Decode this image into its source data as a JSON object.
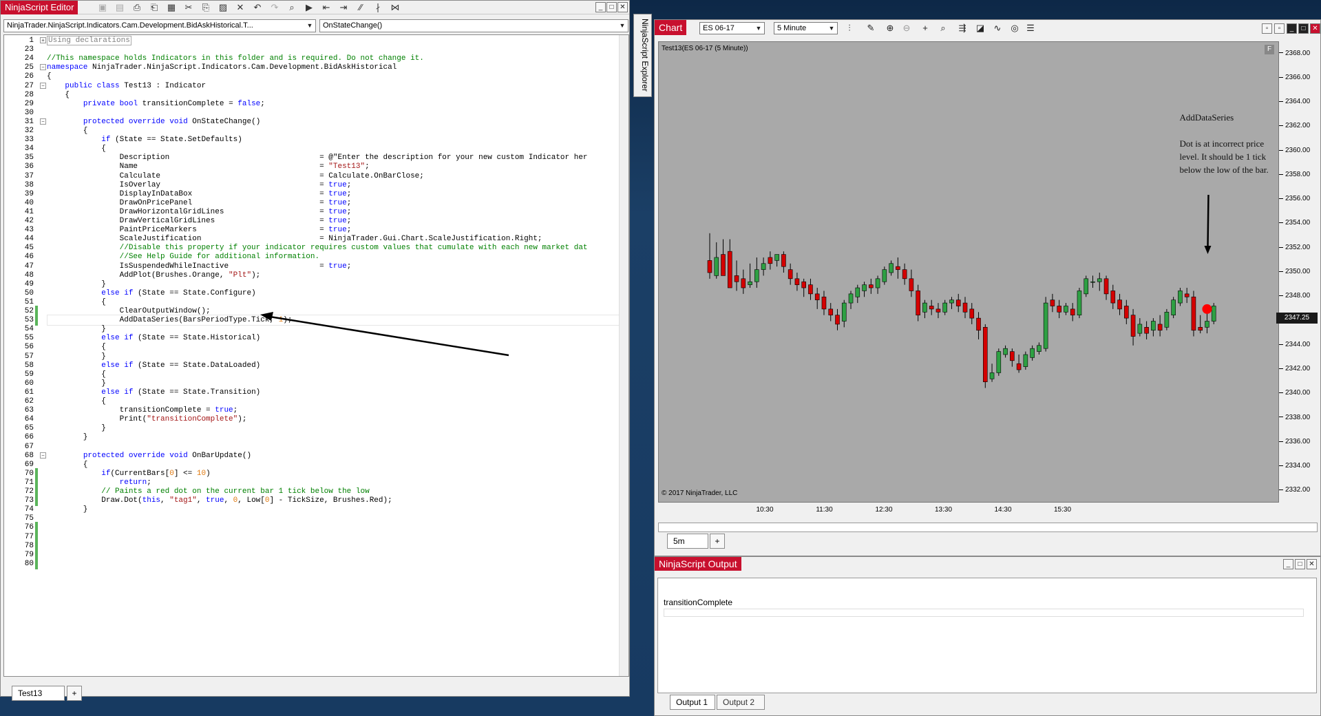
{
  "editor": {
    "title": "NinjaScript Editor",
    "file_dropdown": "NinjaTrader.NinjaScript.Indicators.Cam.Development.BidAskHistorical.T...",
    "method_dropdown": "OnStateChange()",
    "tab_name": "Test13",
    "add_tab": "+",
    "lines": [
      {
        "n": "1",
        "t": "Using declarations"
      },
      {
        "n": "23",
        "t": ""
      },
      {
        "n": "24",
        "t": "//This namespace holds Indicators in this folder and is required. Do not change it."
      },
      {
        "n": "25",
        "t": "namespace NinjaTrader.NinjaScript.Indicators.Cam.Development.BidAskHistorical"
      },
      {
        "n": "26",
        "t": "{"
      },
      {
        "n": "27",
        "t": "    public class Test13 : Indicator"
      },
      {
        "n": "28",
        "t": "    {"
      },
      {
        "n": "29",
        "t": "        private bool transitionComplete = false;"
      },
      {
        "n": "30",
        "t": ""
      },
      {
        "n": "31",
        "t": "        protected override void OnStateChange()"
      },
      {
        "n": "32",
        "t": "        {"
      },
      {
        "n": "33",
        "t": "            if (State == State.SetDefaults)"
      },
      {
        "n": "34",
        "t": "            {"
      },
      {
        "n": "35",
        "t": "                Description                                 = @\"Enter the description for your new custom Indicator her"
      },
      {
        "n": "36",
        "t": "                Name                                        = \"Test13\";"
      },
      {
        "n": "37",
        "t": "                Calculate                                   = Calculate.OnBarClose;"
      },
      {
        "n": "38",
        "t": "                IsOverlay                                   = true;"
      },
      {
        "n": "39",
        "t": "                DisplayInDataBox                            = true;"
      },
      {
        "n": "40",
        "t": "                DrawOnPricePanel                            = true;"
      },
      {
        "n": "41",
        "t": "                DrawHorizontalGridLines                     = true;"
      },
      {
        "n": "42",
        "t": "                DrawVerticalGridLines                       = true;"
      },
      {
        "n": "43",
        "t": "                PaintPriceMarkers                           = true;"
      },
      {
        "n": "44",
        "t": "                ScaleJustification                          = NinjaTrader.Gui.Chart.ScaleJustification.Right;"
      },
      {
        "n": "45",
        "t": "                //Disable this property if your indicator requires custom values that cumulate with each new market dat"
      },
      {
        "n": "46",
        "t": "                //See Help Guide for additional information."
      },
      {
        "n": "47",
        "t": "                IsSuspendedWhileInactive                    = true;"
      },
      {
        "n": "48",
        "t": "                AddPlot(Brushes.Orange, \"Plt\");"
      },
      {
        "n": "49",
        "t": "            }"
      },
      {
        "n": "50",
        "t": "            else if (State == State.Configure)"
      },
      {
        "n": "51",
        "t": "            {"
      },
      {
        "n": "52",
        "t": "                ClearOutputWindow();"
      },
      {
        "n": "53",
        "t": "                AddDataSeries(BarsPeriodType.Tick, 1);"
      },
      {
        "n": "54",
        "t": "            }"
      },
      {
        "n": "55",
        "t": "            else if (State == State.Historical)"
      },
      {
        "n": "56",
        "t": "            {"
      },
      {
        "n": "57",
        "t": "            }"
      },
      {
        "n": "58",
        "t": "            else if (State == State.DataLoaded)"
      },
      {
        "n": "59",
        "t": "            {"
      },
      {
        "n": "60",
        "t": "            }"
      },
      {
        "n": "61",
        "t": "            else if (State == State.Transition)"
      },
      {
        "n": "62",
        "t": "            {"
      },
      {
        "n": "63",
        "t": "                transitionComplete = true;"
      },
      {
        "n": "64",
        "t": "                Print(\"transitionComplete\");"
      },
      {
        "n": "65",
        "t": "            }"
      },
      {
        "n": "66",
        "t": "        }"
      },
      {
        "n": "67",
        "t": ""
      },
      {
        "n": "68",
        "t": "        protected override void OnBarUpdate()"
      },
      {
        "n": "69",
        "t": "        {"
      },
      {
        "n": "70",
        "t": "            if(CurrentBars[0] <= 10)"
      },
      {
        "n": "71",
        "t": "                return;"
      },
      {
        "n": "72",
        "t": "            // Paints a red dot on the current bar 1 tick below the low"
      },
      {
        "n": "73",
        "t": "            Draw.Dot(this, \"tag1\", true, 0, Low[0] - TickSize, Brushes.Red);"
      },
      {
        "n": "74",
        "t": "        }"
      },
      {
        "n": "75",
        "t": ""
      },
      {
        "n": "76",
        "t": ""
      },
      {
        "n": "77",
        "t": ""
      },
      {
        "n": "78",
        "t": ""
      },
      {
        "n": "79",
        "t": ""
      },
      {
        "n": "80",
        "t": ""
      }
    ]
  },
  "explorer": {
    "label": "NinjaScript Explorer"
  },
  "chart": {
    "title": "Chart",
    "instrument": "ES 06-17",
    "interval": "5 Minute",
    "plot_label": "Test13(ES 06-17 (5 Minute))",
    "copyright": "© 2017 NinjaTrader, LLC",
    "price_badge": "2347.25",
    "tab_name": "5m",
    "add_tab": "+",
    "annotation_title": "AddDataSeries",
    "annotation_text": "Dot is at incorrect price level.  It should be 1 tick below the low of the bar.",
    "f_button": "F"
  },
  "chart_data": {
    "type": "candlestick",
    "y_ticks": [
      "2368.00",
      "2366.00",
      "2364.00",
      "2362.00",
      "2360.00",
      "2358.00",
      "2356.00",
      "2354.00",
      "2352.00",
      "2350.00",
      "2348.00",
      "2346.00",
      "2344.00",
      "2342.00",
      "2340.00",
      "2338.00",
      "2336.00",
      "2334.00",
      "2332.00"
    ],
    "x_ticks": [
      "10:30",
      "11:30",
      "12:30",
      "13:30",
      "14:30",
      "15:30"
    ],
    "ylim": [
      2331,
      2369
    ],
    "candles": [
      [
        2351.0,
        2353.25,
        2350.0,
        2349.5
      ],
      [
        2349.75,
        2352.5,
        2351.25,
        2349.5
      ],
      [
        2351.5,
        2352.75,
        2349.75,
        2350.75
      ],
      [
        2351.75,
        2352.75,
        2348.75,
        2349.75
      ],
      [
        2349.75,
        2351.0,
        2349.25,
        2348.5
      ],
      [
        2349.5,
        2350.25,
        2348.75,
        2348.25
      ],
      [
        2349.0,
        2350.75,
        2349.25,
        2348.75
      ],
      [
        2349.25,
        2351.25,
        2350.25,
        2348.75
      ],
      [
        2350.25,
        2351.25,
        2350.75,
        2349.75
      ],
      [
        2351.25,
        2351.75,
        2350.75,
        2350.25
      ],
      [
        2351.0,
        2351.5,
        2351.5,
        2350.5
      ],
      [
        2351.5,
        2351.75,
        2350.5,
        2350.0
      ],
      [
        2350.25,
        2350.75,
        2349.5,
        2349.0
      ],
      [
        2349.5,
        2350.0,
        2349.0,
        2348.5
      ],
      [
        2349.25,
        2349.5,
        2348.75,
        2348.0
      ],
      [
        2349.0,
        2349.5,
        2348.25,
        2347.75
      ],
      [
        2348.25,
        2348.75,
        2347.75,
        2347.0
      ],
      [
        2348.0,
        2348.5,
        2347.0,
        2346.5
      ],
      [
        2347.0,
        2347.5,
        2346.5,
        2346.0
      ],
      [
        2346.5,
        2347.0,
        2345.75,
        2345.25
      ],
      [
        2346.0,
        2347.75,
        2347.5,
        2345.5
      ],
      [
        2347.5,
        2348.5,
        2348.25,
        2347.0
      ],
      [
        2348.0,
        2349.0,
        2348.75,
        2347.5
      ],
      [
        2348.5,
        2349.25,
        2349.0,
        2348.0
      ],
      [
        2349.0,
        2349.5,
        2348.75,
        2348.25
      ],
      [
        2348.75,
        2349.75,
        2349.5,
        2348.25
      ],
      [
        2349.25,
        2350.5,
        2350.25,
        2349.0
      ],
      [
        2350.0,
        2351.0,
        2350.75,
        2349.75
      ],
      [
        2350.5,
        2351.25,
        2350.25,
        2349.5
      ],
      [
        2350.25,
        2350.75,
        2349.5,
        2349.0
      ],
      [
        2349.5,
        2350.25,
        2348.5,
        2348.0
      ],
      [
        2348.5,
        2349.0,
        2346.5,
        2346.0
      ],
      [
        2346.75,
        2347.75,
        2347.5,
        2346.25
      ],
      [
        2347.25,
        2347.75,
        2347.0,
        2346.5
      ],
      [
        2347.0,
        2347.5,
        2346.75,
        2346.25
      ],
      [
        2346.75,
        2347.75,
        2347.5,
        2346.5
      ],
      [
        2347.5,
        2348.0,
        2347.75,
        2347.0
      ],
      [
        2347.75,
        2348.25,
        2347.25,
        2346.75
      ],
      [
        2347.5,
        2348.0,
        2346.75,
        2346.25
      ],
      [
        2347.0,
        2347.5,
        2346.25,
        2345.75
      ],
      [
        2346.25,
        2346.75,
        2345.25,
        2344.5
      ],
      [
        2345.5,
        2345.75,
        2341.0,
        2340.5
      ],
      [
        2341.25,
        2342.5,
        2341.75,
        2341.0
      ],
      [
        2341.75,
        2343.75,
        2343.5,
        2341.5
      ],
      [
        2343.25,
        2344.0,
        2343.75,
        2343.0
      ],
      [
        2343.5,
        2343.75,
        2342.75,
        2342.25
      ],
      [
        2342.5,
        2343.25,
        2342.0,
        2341.75
      ],
      [
        2342.25,
        2343.5,
        2343.25,
        2342.0
      ],
      [
        2343.0,
        2344.0,
        2343.75,
        2342.75
      ],
      [
        2343.5,
        2344.25,
        2344.0,
        2343.25
      ],
      [
        2343.75,
        2348.0,
        2347.5,
        2343.5
      ],
      [
        2347.75,
        2348.25,
        2347.25,
        2346.75
      ],
      [
        2347.25,
        2347.75,
        2346.75,
        2346.25
      ],
      [
        2346.75,
        2347.5,
        2347.25,
        2346.5
      ],
      [
        2347.0,
        2347.5,
        2346.5,
        2346.0
      ],
      [
        2346.5,
        2348.75,
        2348.5,
        2346.25
      ],
      [
        2348.25,
        2349.75,
        2349.5,
        2348.0
      ],
      [
        2349.25,
        2349.75,
        2349.25,
        2348.75
      ],
      [
        2349.25,
        2350.0,
        2349.5,
        2348.5
      ],
      [
        2349.5,
        2349.75,
        2348.25,
        2347.75
      ],
      [
        2348.5,
        2349.0,
        2347.5,
        2347.0
      ],
      [
        2347.75,
        2348.25,
        2347.0,
        2346.5
      ],
      [
        2347.25,
        2347.75,
        2346.25,
        2345.75
      ],
      [
        2346.5,
        2347.0,
        2344.75,
        2344.0
      ],
      [
        2345.0,
        2346.25,
        2345.75,
        2344.75
      ],
      [
        2345.5,
        2346.0,
        2345.0,
        2344.5
      ],
      [
        2345.25,
        2346.25,
        2346.0,
        2344.75
      ],
      [
        2345.75,
        2346.5,
        2345.25,
        2344.75
      ],
      [
        2345.5,
        2347.0,
        2346.75,
        2345.25
      ],
      [
        2346.5,
        2348.0,
        2347.75,
        2346.25
      ],
      [
        2347.5,
        2348.75,
        2348.5,
        2347.25
      ],
      [
        2348.25,
        2348.75,
        2348.0,
        2347.5
      ],
      [
        2348.0,
        2348.5,
        2345.25,
        2344.75
      ],
      [
        2345.5,
        2346.5,
        2345.25,
        2345.0
      ],
      [
        2345.5,
        2346.75,
        2346.0,
        2345.0
      ],
      [
        2346.0,
        2347.5,
        2347.25,
        2345.75
      ]
    ],
    "dot_value": 2347.0
  },
  "output": {
    "title": "NinjaScript Output",
    "text": "transitionComplete",
    "tab1": "Output 1",
    "tab2": "Output 2"
  },
  "colors": {
    "title_red": "#c8102e",
    "up_candle": "#2ea043",
    "down_candle": "#d40000",
    "dot": "#ff0000"
  }
}
